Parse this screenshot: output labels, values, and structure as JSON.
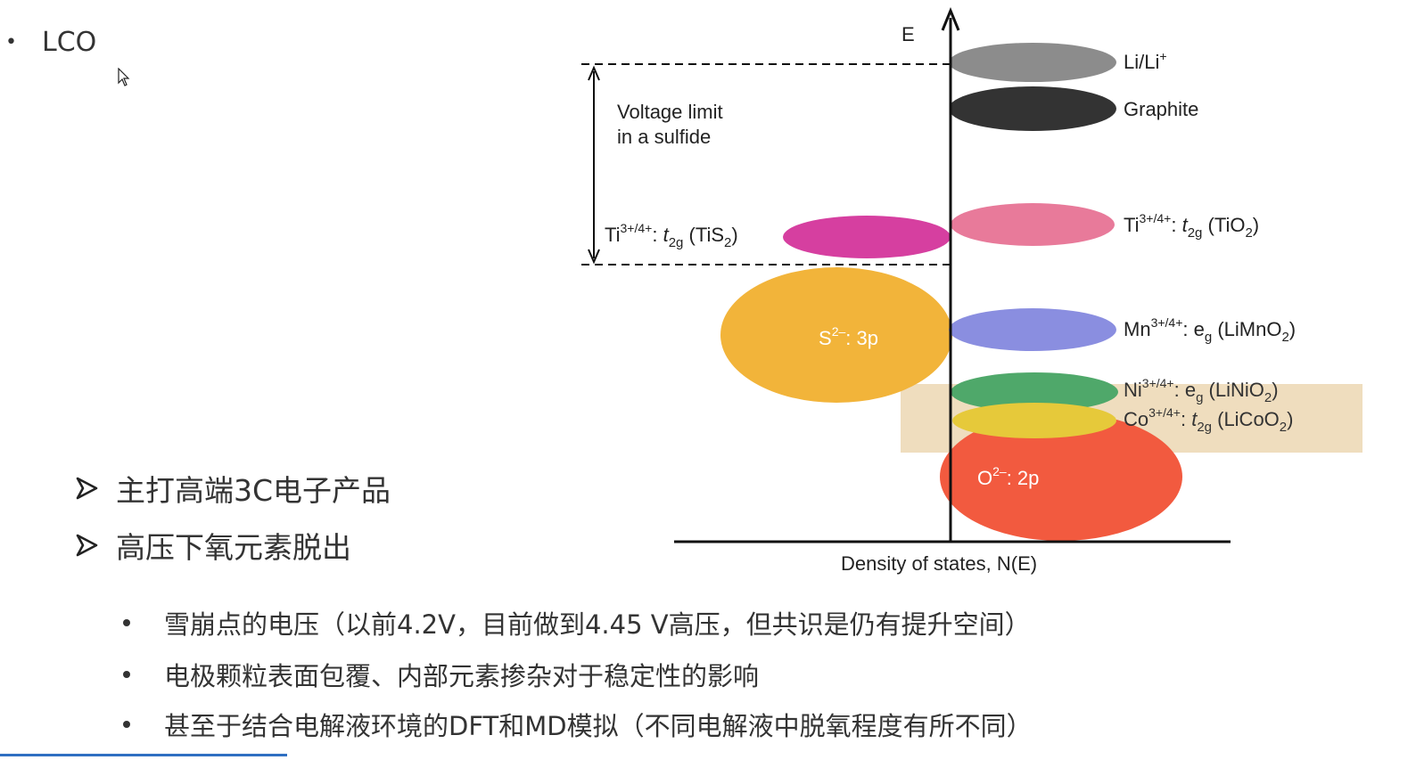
{
  "title": "LCO",
  "points": [
    "主打高端3C电子产品",
    "高压下氧元素脱出"
  ],
  "subpoints": [
    "雪崩点的电压（以前4.2V，目前做到4.45 V高压，但共识是仍有提升空间）",
    "电极颗粒表面包覆、内部元素掺杂对于稳定性的影响",
    "甚至于结合电解液环境的DFT和MD模拟（不同电解液中脱氧程度有所不同）"
  ],
  "figure": {
    "axis_y_label": "E",
    "axis_x_label": "Density of states, N(E)",
    "voltage_limit_line1": "Voltage limit",
    "voltage_limit_line2": "in a sulfide",
    "labels": {
      "lili": "Li/Li",
      "lili_sup": "+",
      "graphite": "Graphite",
      "tis2_base": "Ti",
      "tis2_sup": "3+/4+",
      "tis2_mid": ": ",
      "tis2_t": "t",
      "tis2_sub": "2g",
      "tis2_rest": " (TiS",
      "tis2_sub2": "2",
      "tis2_end": ")",
      "tio2_base": "Ti",
      "tio2_sup": "3+/4+",
      "tio2_mid": ": ",
      "tio2_t": "t",
      "tio2_sub": "2g",
      "tio2_rest": " (TiO",
      "tio2_sub2": "2",
      "tio2_end": ")",
      "s_base": "S",
      "s_sup": "2–",
      "s_rest": ": 3p",
      "mn_base": "Mn",
      "mn_sup": "3+/4+",
      "mn_mid": ": e",
      "mn_sub": "g",
      "mn_rest": " (LiMnO",
      "mn_sub2": "2",
      "mn_end": ")",
      "ni_base": "Ni",
      "ni_sup": "3+/4+",
      "ni_mid": ": e",
      "ni_sub": "g",
      "ni_rest": " (LiNiO",
      "ni_sub2": "2",
      "ni_end": ")",
      "co_base": "Co",
      "co_sup": "3+/4+",
      "co_mid": ": ",
      "co_t": "t",
      "co_sub": "2g",
      "co_rest": " (LiCoO",
      "co_sub2": "2",
      "co_end": ")",
      "o_base": "O",
      "o_sup": "2–",
      "o_rest": ": 2p"
    },
    "colors": {
      "lili": "#8c8c8c",
      "graphite": "#333333",
      "tis2": "#d63fa0",
      "tio2": "#e87a9a",
      "s3p": "#f2b43a",
      "mn": "#8a8ee0",
      "ni": "#4fa86a",
      "co": "#e6c93a",
      "o2p": "#f25a3f",
      "highlight": "#e9d2a8"
    }
  }
}
